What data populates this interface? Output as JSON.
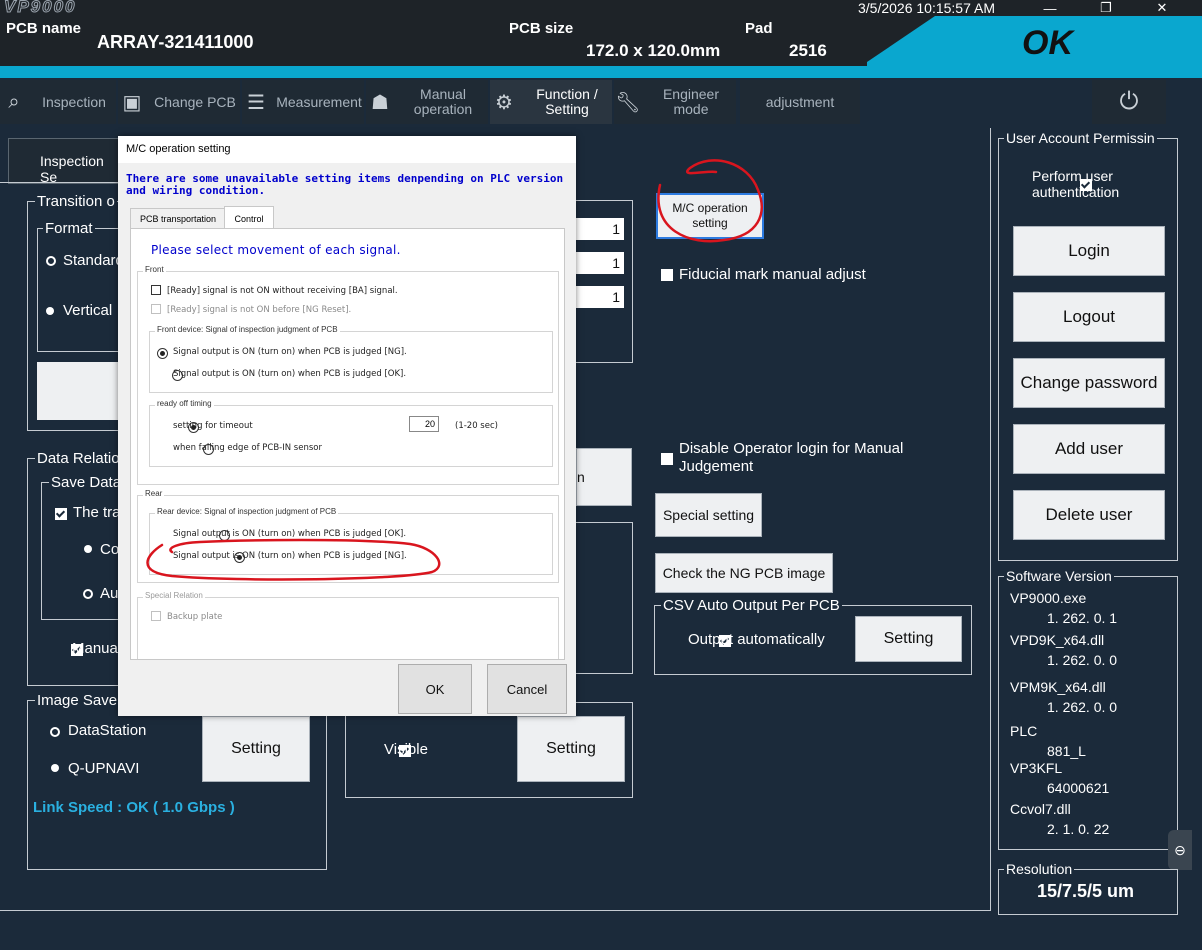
{
  "header": {
    "logo": "VP9000",
    "pcb_name_label": "PCB name",
    "pcb_name_value": "ARRAY-321411000",
    "pcb_size_label": "PCB size",
    "pcb_size_value": "172.0 x 120.0mm",
    "pad_label": "Pad",
    "pad_value": "2516",
    "result": "OK",
    "datetime": "3/5/2026 10:15:57 AM",
    "window_controls": [
      "—",
      "❐",
      "✕"
    ]
  },
  "nav": {
    "items": [
      {
        "label": "Inspection",
        "icon": "search-icon"
      },
      {
        "label": "Change PCB",
        "icon": "board-icon"
      },
      {
        "label": "Measurement",
        "icon": "document-icon"
      },
      {
        "label": "Manual operation",
        "icon": "person-icon"
      },
      {
        "label": "Function / Setting",
        "icon": "gear-icon"
      },
      {
        "label": "Engineer mode",
        "icon": "wrench-icon"
      },
      {
        "label": "adjustment",
        "icon": ""
      }
    ],
    "power_icon": "power-icon"
  },
  "left": {
    "inspection_tab": "Inspection Se",
    "transition_legend": "Transition o",
    "format_legend": "Format",
    "format_options": [
      "Standard",
      "Vertical"
    ],
    "data_relation_legend": "Data Relatio",
    "save_data_legend": "Save Data",
    "the_tra": "The tra",
    "co": "Co",
    "au": "Au",
    "manual": "Manua",
    "image_save_legend": "Image Save",
    "image_save_options": [
      "DataStation",
      "Q-UPNAVI"
    ],
    "setting": "Setting",
    "link_speed": "Link Speed : OK ( 1.0 Gbps )"
  },
  "middle": {
    "num_values": [
      "1",
      "1",
      "1"
    ],
    "n_fragment": "n",
    "visible_label": "Visible",
    "setting": "Setting"
  },
  "center_right": {
    "mc_button": "M/C operation setting",
    "fiducial": "Fiducial mark manual adjust",
    "disable_operator": "Disable Operator login for Manual Judgement",
    "special_setting": "Special setting",
    "check_ng": "Check the NG PCB image",
    "csv_legend": "CSV Auto Output Per PCB",
    "output_auto": "Output automatically",
    "csv_setting": "Setting"
  },
  "user_account": {
    "legend": "User Account Permissin",
    "perform_auth": "Perform user authentication",
    "buttons": [
      "Login",
      "Logout",
      "Change password",
      "Add user",
      "Delete user"
    ]
  },
  "software_version": {
    "legend": "Software Version",
    "items": [
      {
        "name": "VP9000.exe",
        "version": "1. 262. 0. 1"
      },
      {
        "name": "VPD9K_x64.dll",
        "version": "1. 262. 0. 0"
      },
      {
        "name": "VPM9K_x64.dll",
        "version": "1. 262. 0. 0"
      },
      {
        "name": "PLC",
        "version": "881_L"
      },
      {
        "name": "VP3KFL",
        "version": "64000621"
      },
      {
        "name": "Ccvol7.dll",
        "version": "2. 1. 0. 22"
      }
    ]
  },
  "resolution": {
    "legend": "Resolution",
    "value": "15/7.5/5 um"
  },
  "dialog": {
    "title": "M/C operation setting",
    "note": "There are some unavailable setting items denpending on PLC version and wiring condition.",
    "tabs": [
      "PCB transportation",
      "Control"
    ],
    "select_title": "Please select movement of each signal.",
    "front_label": "Front",
    "front_chk1": "[Ready] signal is not ON without receiving [BA] signal.",
    "front_chk2": "[Ready] signal is not ON before [NG Reset].",
    "front_device_label": "Front device: Signal of inspection judgment of PCB",
    "front_opt1": "Signal output is ON (turn on) when PCB is judged [NG].",
    "front_opt2": "Signal output is ON (turn on) when PCB is judged [OK].",
    "ready_off_label": "ready off timing",
    "timeout_label": "setting for timeout",
    "timeout_value": "20",
    "timeout_range": "(1-20 sec)",
    "falling_edge": "when falling edge of PCB-IN sensor",
    "rear_label": "Rear",
    "rear_device_label": "Rear device: Signal of inspection judgment of PCB",
    "rear_opt1": "Signal output is ON (turn on) when PCB is judged [OK].",
    "rear_opt2": "Signal output is ON (turn on) when PCB is judged [NG].",
    "special_relation_label": "Special Relation",
    "backup_plate": "Backup plate",
    "ok": "OK",
    "cancel": "Cancel"
  },
  "colors": {
    "accent": "#0aa7cf",
    "background": "#1b2a3a",
    "link_speed": "#2ab0e0",
    "annotation": "#d9151e",
    "dialog_note": "#0000cc"
  }
}
